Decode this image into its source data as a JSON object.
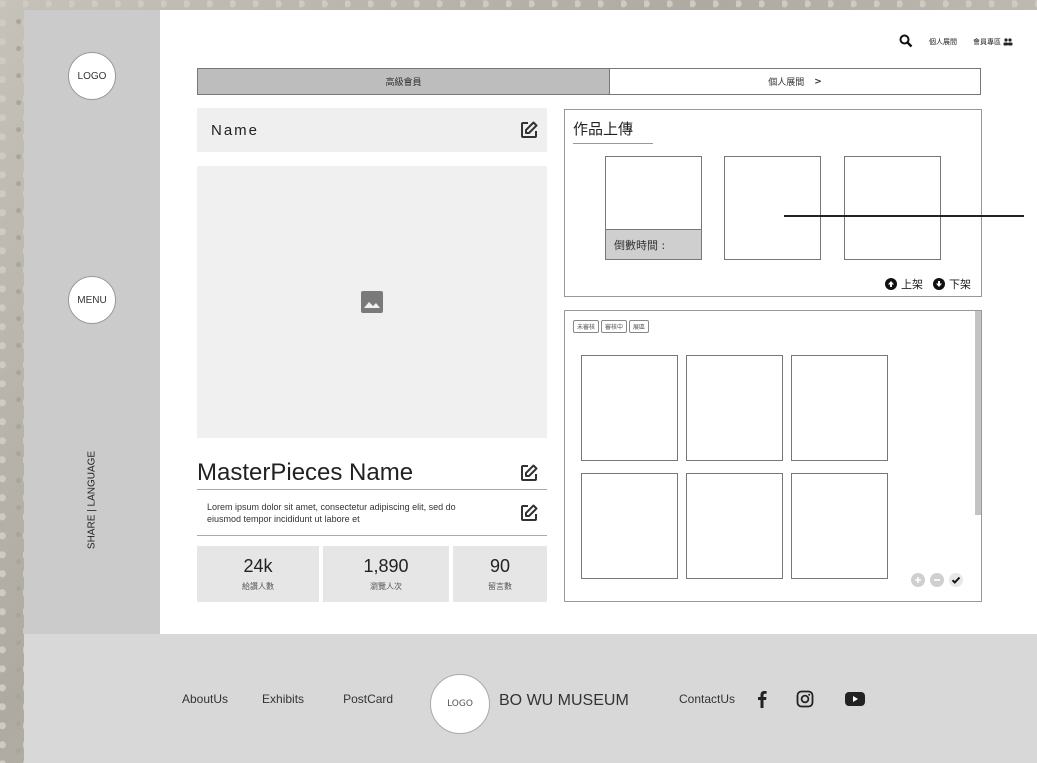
{
  "sidebar": {
    "logo": "LOGO",
    "menu": "MENU",
    "share_language": "SHARE | LANGUAGE"
  },
  "topbar": {
    "personal_exhibit": "個人展間",
    "member_area": "會員專區"
  },
  "tabs": {
    "premium_member": "高級會員",
    "personal_exhibit": "個人展間",
    "chevron": ">"
  },
  "profile": {
    "name": "Name",
    "masterpiece_name": "MasterPieces Name",
    "description": "Lorem ipsum dolor sit amet, consectetur adipiscing elit, sed do eiusmod tempor incididunt ut labore et"
  },
  "stats": [
    {
      "value": "24k",
      "label": "給讚人數"
    },
    {
      "value": "1,890",
      "label": "瀏覽人次"
    },
    {
      "value": "90",
      "label": "留言數"
    }
  ],
  "upload": {
    "title": "作品上傳",
    "countdown": "倒數時間 :",
    "list_up": "上架",
    "list_down": "下架"
  },
  "gallery": {
    "tags": [
      "未審核",
      "審核中",
      "展區"
    ]
  },
  "footer": {
    "about": "AboutUs",
    "exhibits": "Exhibits",
    "postcard": "PostCard",
    "logo": "LOGO",
    "museum": "BO WU MUSEUM",
    "contact": "ContactUs"
  },
  "colors": {
    "sidebar_bg": "#cbcbcb",
    "active_tab": "#bdbdbd",
    "footer_bg": "#d8d8d8"
  }
}
